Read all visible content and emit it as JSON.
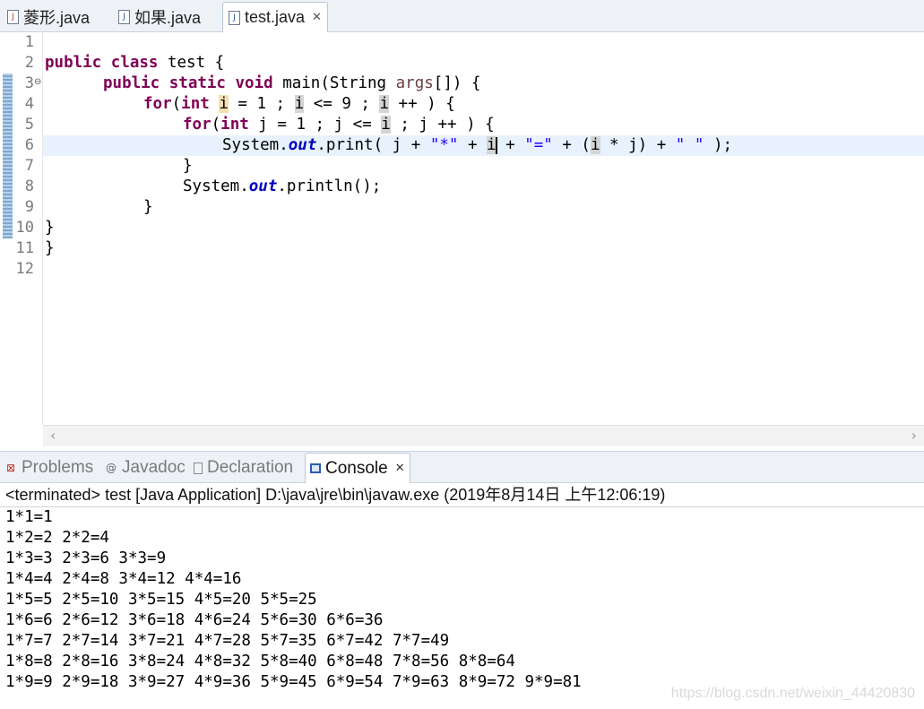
{
  "editor_tabs": [
    {
      "label": "菱形.java",
      "active": false
    },
    {
      "label": "如果.java",
      "active": false
    },
    {
      "label": "test.java",
      "active": true
    }
  ],
  "line_numbers": [
    "1",
    "2",
    "3",
    "4",
    "5",
    "6",
    "7",
    "8",
    "9",
    "10",
    "11",
    "12"
  ],
  "code": {
    "l2_kw": "public class",
    "l2_rest": " test {",
    "l3_kw": "public static void",
    "l3_rest": " main(String ",
    "l3_args": "args",
    "l3_end": "[]) {",
    "for_kw": "for",
    "int_kw": "int",
    "l4_a": "(",
    "l4_b": " ",
    "var_i": "i",
    "l4_c": " = 1 ; ",
    "l4_d": " <= 9 ; ",
    "l4_e": " ++ ) {",
    "l5_a": "(",
    "l5_b": " j = 1 ; j <= ",
    "l5_c": " ; j ++ ) {",
    "l6_a": "System.",
    "out_field": "out",
    "l6_b": ".print( j + ",
    "str_star": "\"*\"",
    "l6_c": " + ",
    "l6_d": " + ",
    "str_eq": "\"=\"",
    "l6_e": " + (",
    "l6_f": " * j) + ",
    "str_space": "\" \"",
    "l6_g": " );",
    "l7": "}",
    "l8_a": "System.",
    "l8_b": ".println();",
    "l9": "}",
    "l10": "}",
    "l11": "}"
  },
  "panel_tabs": [
    {
      "label": "Problems",
      "icon": "problems-icon",
      "active": false
    },
    {
      "label": "Javadoc",
      "icon": "javadoc-icon",
      "active": false
    },
    {
      "label": "Declaration",
      "icon": "declaration-icon",
      "active": false
    },
    {
      "label": "Console",
      "icon": "console-icon",
      "active": true
    }
  ],
  "console": {
    "status": "<terminated> test [Java Application] D:\\java\\jre\\bin\\javaw.exe (2019年8月14日 上午12:06:19)",
    "lines": [
      "1*1=1",
      "1*2=2 2*2=4",
      "1*3=3 2*3=6 3*3=9",
      "1*4=4 2*4=8 3*4=12 4*4=16",
      "1*5=5 2*5=10 3*5=15 4*5=20 5*5=25",
      "1*6=6 2*6=12 3*6=18 4*6=24 5*6=30 6*6=36",
      "1*7=7 2*7=14 3*7=21 4*7=28 5*7=35 6*7=42 7*7=49",
      "1*8=8 2*8=16 3*8=24 4*8=32 5*8=40 6*8=48 7*8=56 8*8=64",
      "1*9=9 2*9=18 3*9=27 4*9=36 5*9=45 6*9=54 7*9=63 8*9=72 9*9=81"
    ]
  },
  "watermark": "https://blog.csdn.net/weixin_44420830",
  "colors": {
    "keyword": "#7f0055",
    "string": "#2a00ff",
    "field": "#0000c0",
    "current_line": "#e8f2fe"
  }
}
